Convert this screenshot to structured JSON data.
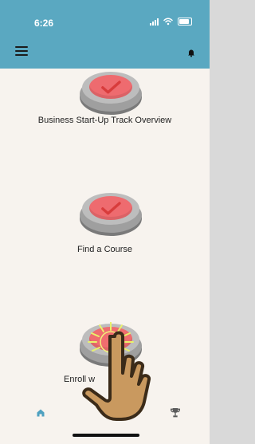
{
  "status": {
    "time": "6:26"
  },
  "nodes": [
    {
      "label": "Business Start-Up Track Overview",
      "state": "completed"
    },
    {
      "label": "Find a Course",
      "state": "completed"
    },
    {
      "label": "Enroll w",
      "state": "active"
    }
  ],
  "tabs": [
    {
      "name": "home",
      "icon": "home-icon"
    },
    {
      "name": "trophy",
      "icon": "trophy-icon"
    }
  ],
  "colors": {
    "header": "#5aa8c1",
    "background": "#f7f3ee",
    "node_red": "#ee6b6f",
    "node_gray": "#bdbdbd",
    "tap_burst": "#e9f26b"
  }
}
